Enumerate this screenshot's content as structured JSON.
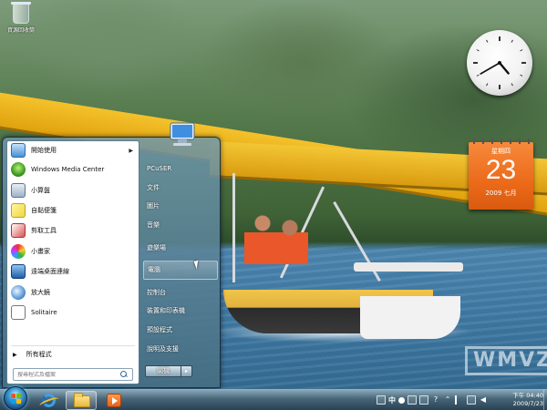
{
  "desktop": {
    "recycle_bin_label": "資源回收筒",
    "watermark": "WMVZ"
  },
  "gadgets": {
    "clock": {
      "hour": 4,
      "minute": 40
    },
    "calendar": {
      "weekday": "星期四",
      "day": "23",
      "year_month": "2009 七月"
    }
  },
  "start_menu": {
    "programs": [
      {
        "label": "開始使用",
        "icon": "getting-started-icon",
        "has_submenu": true
      },
      {
        "label": "Windows Media Center",
        "icon": "media-center-icon"
      },
      {
        "label": "小算盤",
        "icon": "calculator-icon"
      },
      {
        "label": "自黏便箋",
        "icon": "sticky-notes-icon"
      },
      {
        "label": "剪取工具",
        "icon": "snipping-tool-icon"
      },
      {
        "label": "小畫家",
        "icon": "paint-icon"
      },
      {
        "label": "遠端桌面連線",
        "icon": "remote-desktop-icon"
      },
      {
        "label": "放大鏡",
        "icon": "magnifier-icon"
      },
      {
        "label": "Solitaire",
        "icon": "solitaire-icon"
      }
    ],
    "all_programs_label": "所有程式",
    "search_placeholder": "搜尋程式及檔案",
    "places": [
      {
        "label": "PCuSER"
      },
      {
        "label": "文件"
      },
      {
        "label": "圖片"
      },
      {
        "label": "音樂"
      },
      {
        "label": "遊樂場"
      },
      {
        "label": "電腦",
        "highlighted": true
      },
      {
        "label": "控制台"
      },
      {
        "label": "裝置和印表機"
      },
      {
        "label": "預設程式"
      },
      {
        "label": "說明及支援"
      }
    ],
    "shutdown_label": "關機",
    "shutdown_arrow": "▸"
  },
  "taskbar": {
    "pinned": [
      {
        "name": "internet-explorer-icon"
      },
      {
        "name": "windows-explorer-icon",
        "active": true
      },
      {
        "name": "media-player-icon"
      }
    ],
    "tray": {
      "ime_label": "中"
    },
    "time": "下午 04:40",
    "date": "2009/7/23"
  },
  "colors": {
    "calendar_orange": "#ec6a1a",
    "taskbar": "#3f6479",
    "start_orb": "#3f9ed6"
  }
}
